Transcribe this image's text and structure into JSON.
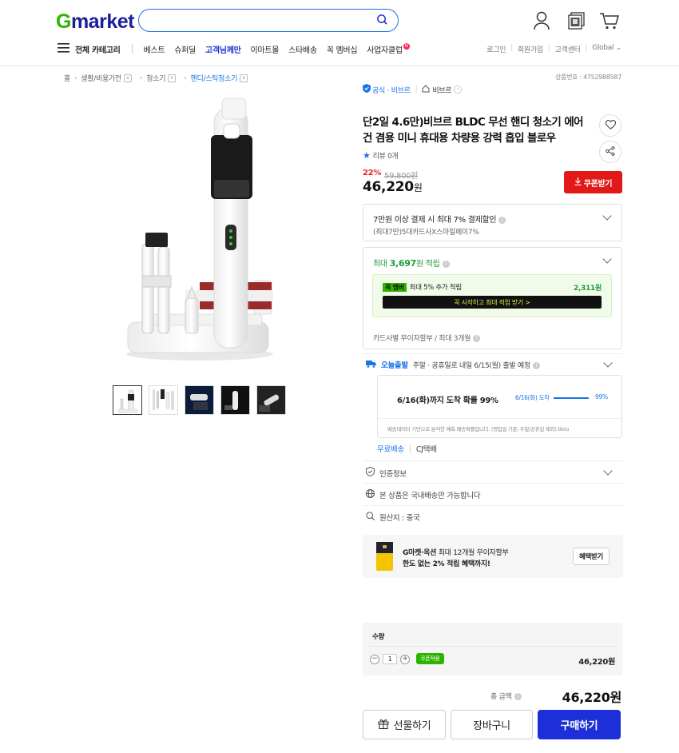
{
  "header": {
    "logo_g": "G",
    "logo_rest": "market",
    "search_placeholder": "",
    "icons": [
      "user-icon",
      "my-gmarket-icon",
      "cart-icon"
    ]
  },
  "nav": {
    "all_category": "전체 카테고리",
    "items": [
      "베스트",
      "슈퍼딜",
      "고객님께만",
      "이마트몰",
      "스타배송",
      "꼭 멤버십",
      "사업자클럽"
    ],
    "highlight_index": 2,
    "new_badge": "N",
    "util": [
      "로그인",
      "회원가입",
      "고객센터",
      "Global"
    ]
  },
  "breadcrumb": [
    "홈",
    "생활/비용가전",
    "청소기",
    "핸디/스틱청소기"
  ],
  "product_no": "상품번호 : 4752988587",
  "badges": {
    "official": "공식 · 비브르",
    "brand": "비브르"
  },
  "title": "단2일 4.6만)비브르 BLDC 무선 핸디 청소기 에어건 겸용 미니 휴대용 차량용 강력 흡입 블로우",
  "review": "리뷰 0개",
  "discount_rate": "22%",
  "original_price": "59,800원",
  "price": "46,220",
  "price_unit": "원",
  "coupon_label": "쿠폰받기",
  "card_discount": {
    "title": "7만원 이상 결제 시 최대 7% 결제할인",
    "sub": "(최대7만)5대카드사X스마일페이7%"
  },
  "points": {
    "prefix": "최대 ",
    "amount": "3,697",
    "suffix": "원 적립",
    "member_badge": "꼭 멤버",
    "member_text": "최대 5% 추가 적립",
    "member_amount": "2,311원",
    "member_cta": "꼭 시작하고 최대 적립 받기 >",
    "installment": "카드사별 무이자할부 / 최대 3개월"
  },
  "delivery": {
    "badge": "오늘출발",
    "text": "주말 · 공휴일로 내일 6/15(월) 출발 예정",
    "forecast": "6/16(화)까지 도착 확률 99%",
    "forecast_label": "6/16(화) 도착",
    "forecast_pct": "99%",
    "forecast_value": 0.99,
    "note": "배송데이터 기반으로 분석한 예측 배송확률입니다. (영업일 기준, 주말/공휴일 제외)",
    "beta": "Beta",
    "free": "무료배송",
    "carrier": "CJ택배"
  },
  "cert": "인증정보",
  "domestic": "본 상품은 국내배송만 가능합니다",
  "origin": "원산지 : 중국",
  "promo": {
    "line1_bold": "G마켓·옥션",
    "line1": " 최대 12개월 무이자할부",
    "line2": "한도 없는 2% 적립 혜택까지!",
    "button": "혜택받기"
  },
  "quantity": {
    "label": "수량",
    "value": "1",
    "coupon_tag": "쿠폰적용",
    "line_price": "46,220원"
  },
  "total": {
    "label": "총 금액",
    "amount": "46,220원"
  },
  "buttons": {
    "gift": "선물하기",
    "cart": "장바구니",
    "buy": "구매하기"
  },
  "colors": {
    "brand_blue": "#1c2fd8",
    "accent_red": "#e21919",
    "green": "#2db400"
  }
}
